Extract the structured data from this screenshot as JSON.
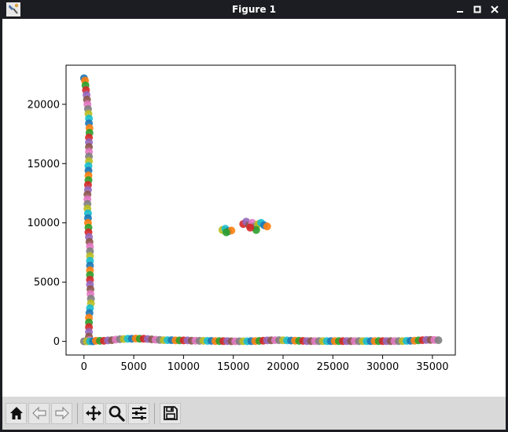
{
  "window": {
    "title": "Figure 1",
    "controls": [
      "minimize",
      "maximize",
      "close"
    ]
  },
  "toolbar": {
    "buttons": [
      "home",
      "back",
      "forward",
      "pan",
      "zoom",
      "configure-subplots",
      "save"
    ]
  },
  "colors": {
    "titlebar": "#1c1d22",
    "toolbar": "#d9d9d9",
    "marker_palette": [
      "#1f77b4",
      "#ff7f0e",
      "#2ca02c",
      "#d62728",
      "#9467bd",
      "#8c564b",
      "#e377c2",
      "#7f7f7f",
      "#bcbd22",
      "#17becf"
    ]
  },
  "chart_data": {
    "type": "scatter",
    "title": "",
    "xlabel": "",
    "ylabel": "",
    "xlim": [
      -1800,
      37300
    ],
    "ylim": [
      -1150,
      23300
    ],
    "xticks": [
      0,
      5000,
      10000,
      15000,
      20000,
      25000,
      30000,
      35000
    ],
    "yticks": [
      0,
      5000,
      10000,
      15000,
      20000
    ],
    "grid": false,
    "legend": "none",
    "series": [
      {
        "points": [
          [
            0,
            22200
          ],
          [
            100,
            22000
          ],
          [
            150,
            21600
          ],
          [
            200,
            21200
          ],
          [
            250,
            20800
          ],
          [
            300,
            20400
          ],
          [
            350,
            20000
          ],
          [
            400,
            19600
          ],
          [
            450,
            19200
          ],
          [
            500,
            18800
          ],
          [
            500,
            18400
          ],
          [
            550,
            18000
          ],
          [
            550,
            17600
          ],
          [
            500,
            17200
          ],
          [
            500,
            16800
          ],
          [
            500,
            16400
          ],
          [
            500,
            16000
          ],
          [
            500,
            15600
          ],
          [
            500,
            15200
          ],
          [
            450,
            14800
          ],
          [
            450,
            14400
          ],
          [
            450,
            14000
          ],
          [
            450,
            13600
          ],
          [
            400,
            13200
          ],
          [
            400,
            12800
          ],
          [
            350,
            12400
          ],
          [
            350,
            12000
          ],
          [
            350,
            11600
          ],
          [
            350,
            11200
          ],
          [
            400,
            10800
          ],
          [
            400,
            10400
          ],
          [
            400,
            10000
          ],
          [
            450,
            9600
          ],
          [
            450,
            9200
          ],
          [
            500,
            8800
          ],
          [
            550,
            8400
          ],
          [
            600,
            8000
          ],
          [
            600,
            7600
          ],
          [
            600,
            7200
          ],
          [
            600,
            6800
          ],
          [
            600,
            6400
          ],
          [
            600,
            6000
          ],
          [
            600,
            5600
          ],
          [
            600,
            5200
          ],
          [
            600,
            4800
          ],
          [
            650,
            4400
          ],
          [
            650,
            4000
          ],
          [
            700,
            3600
          ],
          [
            700,
            3200
          ],
          [
            600,
            2800
          ],
          [
            550,
            2400
          ],
          [
            500,
            2000
          ],
          [
            500,
            1600
          ],
          [
            500,
            1200
          ],
          [
            500,
            800
          ],
          [
            500,
            400
          ],
          [
            550,
            100
          ],
          [
            0,
            0
          ],
          [
            300,
            0
          ],
          [
            600,
            0
          ],
          [
            900,
            0
          ],
          [
            1200,
            50
          ],
          [
            1600,
            50
          ],
          [
            2000,
            50
          ],
          [
            2400,
            80
          ],
          [
            2800,
            100
          ],
          [
            3200,
            150
          ],
          [
            3600,
            180
          ],
          [
            4000,
            200
          ],
          [
            4400,
            220
          ],
          [
            4800,
            230
          ],
          [
            5200,
            240
          ],
          [
            5600,
            230
          ],
          [
            6000,
            220
          ],
          [
            6400,
            200
          ],
          [
            6800,
            170
          ],
          [
            7200,
            140
          ],
          [
            7600,
            120
          ],
          [
            8000,
            100
          ],
          [
            8400,
            100
          ],
          [
            8800,
            100
          ],
          [
            9200,
            80
          ],
          [
            9600,
            80
          ],
          [
            10000,
            80
          ],
          [
            10400,
            80
          ],
          [
            10800,
            60
          ],
          [
            11200,
            60
          ],
          [
            11600,
            50
          ],
          [
            12000,
            50
          ],
          [
            12400,
            40
          ],
          [
            12800,
            40
          ],
          [
            13200,
            30
          ],
          [
            13600,
            30
          ],
          [
            14000,
            20
          ],
          [
            14400,
            20
          ],
          [
            14800,
            10
          ],
          [
            15200,
            10
          ],
          [
            15600,
            10
          ],
          [
            16000,
            10
          ],
          [
            16400,
            10
          ],
          [
            16800,
            20
          ],
          [
            17200,
            30
          ],
          [
            17600,
            40
          ],
          [
            18000,
            60
          ],
          [
            18400,
            80
          ],
          [
            18800,
            90
          ],
          [
            19200,
            100
          ],
          [
            19600,
            100
          ],
          [
            20000,
            90
          ],
          [
            20400,
            80
          ],
          [
            20800,
            70
          ],
          [
            21200,
            60
          ],
          [
            21600,
            50
          ],
          [
            22000,
            40
          ],
          [
            22400,
            30
          ],
          [
            22800,
            30
          ],
          [
            23200,
            20
          ],
          [
            23600,
            20
          ],
          [
            24000,
            20
          ],
          [
            24400,
            20
          ],
          [
            24800,
            20
          ],
          [
            25200,
            20
          ],
          [
            25600,
            20
          ],
          [
            26000,
            20
          ],
          [
            26400,
            20
          ],
          [
            26800,
            20
          ],
          [
            27200,
            20
          ],
          [
            27600,
            20
          ],
          [
            28000,
            20
          ],
          [
            28400,
            20
          ],
          [
            28800,
            20
          ],
          [
            29200,
            20
          ],
          [
            29600,
            20
          ],
          [
            30000,
            20
          ],
          [
            30400,
            20
          ],
          [
            30800,
            20
          ],
          [
            31200,
            20
          ],
          [
            31600,
            20
          ],
          [
            32000,
            30
          ],
          [
            32400,
            40
          ],
          [
            32800,
            50
          ],
          [
            33200,
            60
          ],
          [
            33600,
            80
          ],
          [
            34000,
            100
          ],
          [
            34400,
            120
          ],
          [
            34800,
            130
          ],
          [
            35200,
            120
          ],
          [
            35600,
            100
          ],
          [
            13900,
            9400
          ],
          [
            14200,
            9500
          ],
          [
            14500,
            9300
          ],
          [
            14800,
            9350
          ],
          [
            14300,
            9200
          ],
          [
            16000,
            9900
          ],
          [
            16300,
            10100
          ],
          [
            16600,
            9800
          ],
          [
            16900,
            10000
          ],
          [
            17200,
            9700
          ],
          [
            17500,
            9900
          ],
          [
            17800,
            10000
          ],
          [
            18100,
            9800
          ],
          [
            18400,
            9700
          ],
          [
            17300,
            9400
          ],
          [
            16700,
            9600
          ]
        ]
      }
    ]
  }
}
